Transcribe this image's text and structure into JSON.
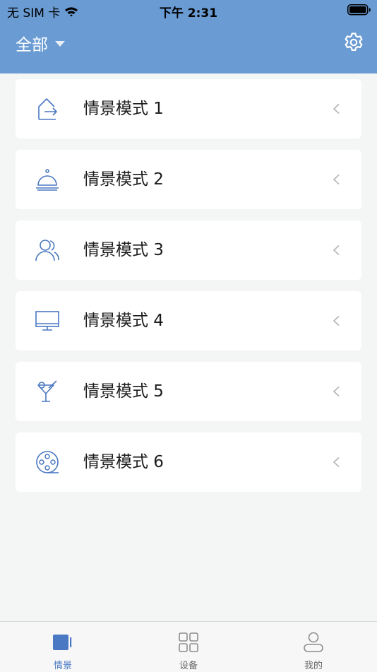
{
  "status_bar": {
    "carrier": "无 SIM 卡",
    "time": "下午 2:31",
    "icons": [
      "wifi-icon",
      "battery-icon"
    ]
  },
  "header": {
    "title": "全部",
    "icons": [
      "chevron-down-icon",
      "gear-icon"
    ]
  },
  "scenes": [
    {
      "label": "情景模式 1",
      "icon": "home-exit-icon"
    },
    {
      "label": "情景模式 2",
      "icon": "dining-cloche-icon"
    },
    {
      "label": "情景模式 3",
      "icon": "people-icon"
    },
    {
      "label": "情景模式 4",
      "icon": "monitor-icon"
    },
    {
      "label": "情景模式 5",
      "icon": "cocktail-icon"
    },
    {
      "label": "情景模式 6",
      "icon": "film-reel-icon"
    }
  ],
  "tabbar": {
    "tabs": [
      {
        "label": "情景",
        "icon": "scene-icon",
        "active": true
      },
      {
        "label": "设备",
        "icon": "device-grid-icon",
        "active": false
      },
      {
        "label": "我的",
        "icon": "profile-icon",
        "active": false
      }
    ]
  },
  "colors": {
    "header": "#6a9bd3",
    "accent": "#4a78c2",
    "inactive": "#8e8e8e"
  }
}
